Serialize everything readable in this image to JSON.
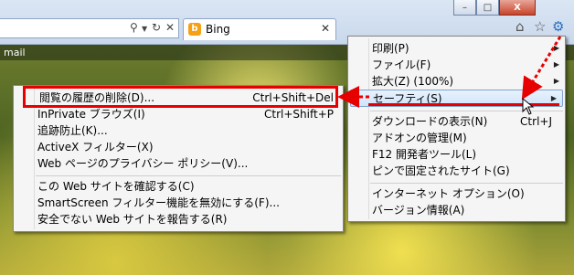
{
  "browser": {
    "tab_title": "Bing",
    "tab_icon_letter": "b",
    "icons": [
      "search-icon",
      "dropdown-icon",
      "refresh-icon",
      "close-icon",
      "home-icon",
      "favorites-star-icon",
      "tools-gear-icon"
    ],
    "window_controls": {
      "minimize": "–",
      "maximize": "□",
      "close": "X"
    }
  },
  "page": {
    "header_text": "mail"
  },
  "tools_menu": {
    "items": [
      {
        "label": "印刷(P)",
        "shortcut": "",
        "submenu": true
      },
      {
        "label": "ファイル(F)",
        "shortcut": "",
        "submenu": true
      },
      {
        "label": "拡大(Z) (100%)",
        "shortcut": "",
        "submenu": true
      },
      {
        "label": "セーフティ(S)",
        "shortcut": "",
        "submenu": true,
        "highlighted": true
      },
      {
        "label": "ダウンロードの表示(N)",
        "shortcut": "Ctrl+J",
        "submenu": false
      },
      {
        "label": "アドオンの管理(M)",
        "shortcut": "",
        "submenu": false
      },
      {
        "label": "F12 開発者ツール(L)",
        "shortcut": "",
        "submenu": false
      },
      {
        "label": "ピンで固定されたサイト(G)",
        "shortcut": "",
        "submenu": false
      },
      {
        "label": "インターネット オプション(O)",
        "shortcut": "",
        "submenu": false
      },
      {
        "label": "バージョン情報(A)",
        "shortcut": "",
        "submenu": false
      }
    ]
  },
  "safety_menu": {
    "items": [
      {
        "label": "閲覧の履歴の削除(D)...",
        "shortcut": "Ctrl+Shift+Del",
        "highlighted": true
      },
      {
        "label": "InPrivate ブラウズ(I)",
        "shortcut": "Ctrl+Shift+P"
      },
      {
        "label": "追跡防止(K)...",
        "shortcut": ""
      },
      {
        "label": "ActiveX フィルター(X)",
        "shortcut": ""
      },
      {
        "label": "Web ページのプライバシー ポリシー(V)...",
        "shortcut": ""
      },
      {
        "label": "この Web サイトを確認する(C)",
        "shortcut": ""
      },
      {
        "label": "SmartScreen フィルター機能を無効にする(F)...",
        "shortcut": ""
      },
      {
        "label": "安全でない Web サイトを報告する(R)",
        "shortcut": ""
      }
    ]
  },
  "colors": {
    "annotation_red": "#e60000",
    "menu_bg": "#f5f5f5",
    "highlight": "#cfe4fb"
  }
}
